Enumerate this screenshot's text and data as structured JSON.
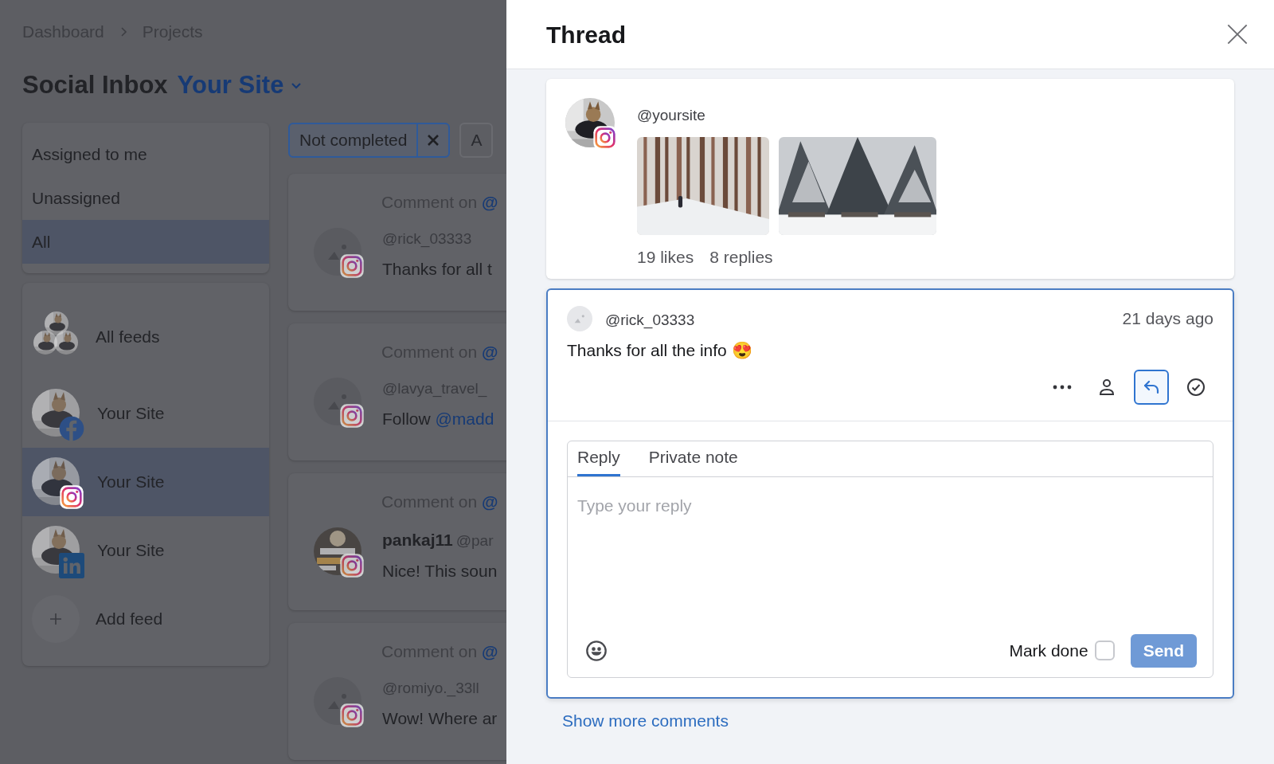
{
  "breadcrumb": [
    "Dashboard",
    "Projects"
  ],
  "page_title": "Social Inbox",
  "site_selector": "Your Site",
  "filters": [
    {
      "label": "Not completed",
      "removable": true
    },
    {
      "label": "A",
      "removable": false
    }
  ],
  "sidebar": {
    "assignment": [
      {
        "label": "Assigned to me",
        "selected": false
      },
      {
        "label": "Unassigned",
        "selected": false
      },
      {
        "label": "All",
        "selected": true
      }
    ],
    "feeds": [
      {
        "label": "All feeds",
        "kind": "all",
        "selected": false
      },
      {
        "label": "Your Site",
        "kind": "facebook",
        "selected": false
      },
      {
        "label": "Your Site",
        "kind": "instagram",
        "selected": true
      },
      {
        "label": "Your Site",
        "kind": "linkedin",
        "selected": false
      }
    ],
    "add_feed": "Add feed"
  },
  "inbox": [
    {
      "heading": "Comment on",
      "mention": "@",
      "avatar": {
        "kind": "placeholder"
      },
      "author": "@rick_03333",
      "text": "Thanks for all t"
    },
    {
      "heading": "Comment on",
      "mention": "@",
      "avatar": {
        "kind": "placeholder"
      },
      "author": "@lavya_travel_",
      "text": "Follow ",
      "link": "@madd"
    },
    {
      "heading": "Comment on",
      "mention": "@",
      "name": "pankaj11",
      "author": "@par",
      "text": "Nice! This soun"
    },
    {
      "heading": "Comment on",
      "mention": "@",
      "avatar": {
        "kind": "placeholder"
      },
      "author": "@romiyo._33ll",
      "text": "Wow! Where ar"
    }
  ],
  "thread": {
    "title": "Thread",
    "post": {
      "handle": "@yoursite",
      "likes": "19 likes",
      "replies": "8 replies"
    },
    "comment": {
      "author": "@rick_03333",
      "time": "21 days ago",
      "text": "Thanks for all the info 😍",
      "actions": [
        {
          "kind": "more",
          "selected": false
        },
        {
          "kind": "assign",
          "selected": false
        },
        {
          "kind": "reply",
          "selected": true
        },
        {
          "kind": "done",
          "selected": false
        }
      ]
    },
    "composer": {
      "tabs": [
        {
          "label": "Reply",
          "selected": true
        },
        {
          "label": "Private note",
          "selected": false
        }
      ],
      "placeholder": "Type your reply",
      "mark_done": {
        "label": "Mark done",
        "checked": false
      },
      "send": {
        "label": "Send",
        "disabled": true
      }
    },
    "show_more": "Show more comments"
  }
}
